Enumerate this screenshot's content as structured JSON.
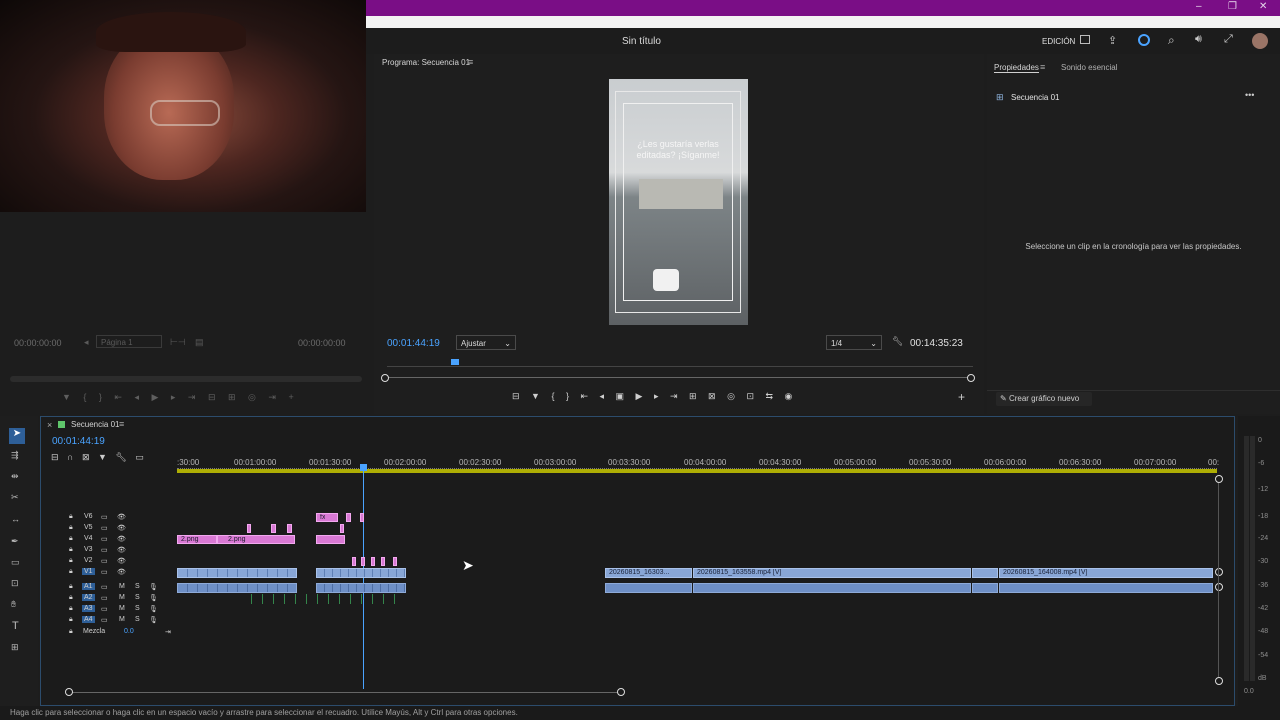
{
  "window": {
    "controls": [
      "–",
      "❐",
      "✕"
    ]
  },
  "header": {
    "title": "Sin título",
    "workspace": "EDICIÓN"
  },
  "source_monitor": {
    "timecode_left": "00:00:00:00",
    "page_select": "Página 1",
    "timecode_right": "00:00:00:00"
  },
  "program": {
    "tab": "Programa: Secuencia 01",
    "overlay_text": "¿Les gustaría verlas editadas? ¡Síganme!",
    "timecode": "00:01:44:19",
    "fit": "Ajustar",
    "resolution": "1/4",
    "duration": "00:14:35:23"
  },
  "properties": {
    "tab_active": "Propiedades",
    "tab_other": "Sonido esencial",
    "sequence": "Secuencia 01",
    "message": "Seleccione un clip en la cronología para ver las propiedades.",
    "button": "Crear gráfico nuevo"
  },
  "timeline": {
    "tab": "Secuencia 01",
    "timecode": "00:01:44:19",
    "ruler": [
      ":30:00",
      "00:01:00:00",
      "00:01:30:00",
      "00:02:00:00",
      "00:02:30:00",
      "00:03:00:00",
      "00:03:30:00",
      "00:04:00:00",
      "00:04:30:00",
      "00:05:00:00",
      "00:05:30:00",
      "00:06:00:00",
      "00:06:30:00",
      "00:07:00:00",
      "00:"
    ],
    "video_tracks": [
      "V6",
      "V5",
      "V4",
      "V3",
      "V2",
      "V1"
    ],
    "audio_tracks": [
      "A1",
      "A2",
      "A3",
      "A4"
    ],
    "mix_label": "Mezcla",
    "mix_value": "0.0",
    "clips": {
      "png1": "2.png",
      "png2": "2.png",
      "vid1": "20260815_16303...",
      "vid2": "20260815_163558.mp4 [V]",
      "vid3": "20260815_164008.mp4 [V]"
    }
  },
  "meter": {
    "ticks": [
      "0",
      "-6",
      "-12",
      "-18",
      "-24",
      "-30",
      "-36",
      "-42",
      "-48",
      "-54",
      "dB"
    ],
    "bottom": "0.0"
  },
  "status": "Haga clic para seleccionar o haga clic en un espacio vacío y arrastre para seleccionar el recuadro. Utilice Mayús, Alt y Ctrl para otras opciones.",
  "colors": {
    "accent": "#4aa3ff",
    "title_bar": "#7a0e86",
    "pink_clip": "#d979d4",
    "blue_clip": "#88a6d6"
  }
}
